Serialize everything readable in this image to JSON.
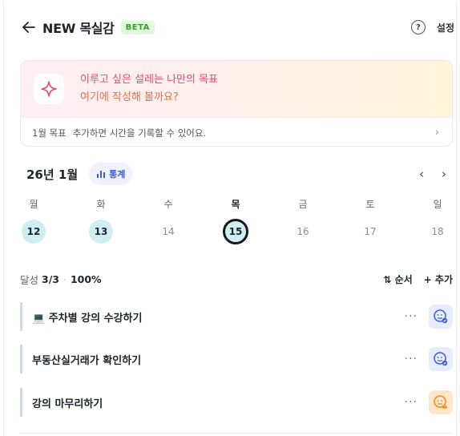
{
  "header": {
    "title": "NEW 목실감",
    "badge": "BETA",
    "help_icon_text": "?",
    "settings_label": "설정"
  },
  "goal_card": {
    "line1": "이루고 싶은 설레는 나만의 목표",
    "line2": "여기에 작성해 볼까요?",
    "footer_prefix": "1월 목표",
    "footer_text": "추가하면 시간을 기록할 수 있어요.",
    "chevron": "›"
  },
  "calendar": {
    "month_label": "26년 1월",
    "stats_label": "통계",
    "prev": "‹",
    "next": "›",
    "weekdays": [
      "월",
      "화",
      "수",
      "목",
      "금",
      "토",
      "일"
    ],
    "dates": [
      "12",
      "13",
      "14",
      "15",
      "16",
      "17",
      "18"
    ]
  },
  "achievement": {
    "label": "달성",
    "count": "3/3",
    "dot": "·",
    "percent": "100%",
    "order_label": "⇅ 순서",
    "add_label": "+ 추가"
  },
  "tasks": [
    {
      "name": "💻 주차별 강의 수강하기",
      "more": "···",
      "status": "blue"
    },
    {
      "name": "부동산실거래가 확인하기",
      "more": "···",
      "status": "blue"
    },
    {
      "name": "강의 마무리하기",
      "more": "···",
      "status": "orange"
    }
  ],
  "colors": {
    "accent_pink": "#e8476f",
    "accent_orange": "#ef6b3d",
    "stats_blue": "#3a5bd9",
    "done_date_bg": "#cfeef3"
  }
}
